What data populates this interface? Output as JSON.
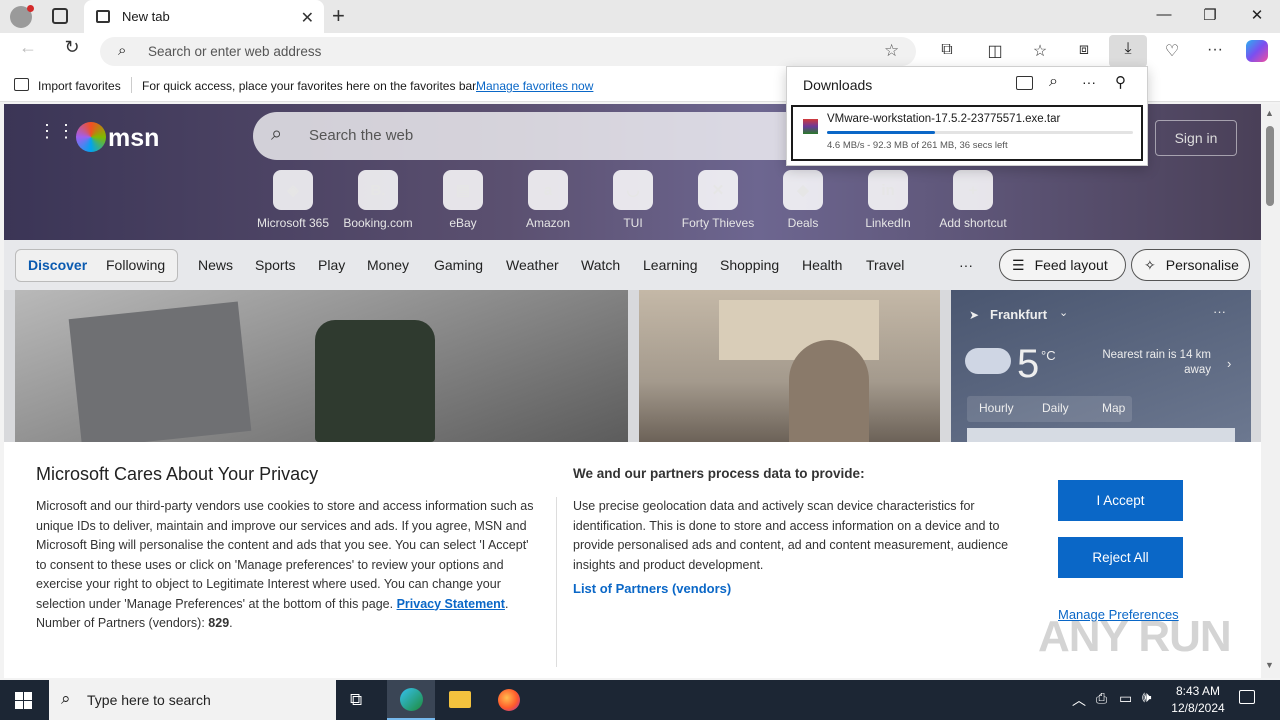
{
  "browser": {
    "tab_title": "New tab",
    "address_placeholder": "Search or enter web address",
    "favbar_import": "Import favorites",
    "favbar_hint": "For quick access, place your favorites here on the favorites bar.",
    "favbar_link": "Manage favorites now"
  },
  "downloads": {
    "title": "Downloads",
    "file_name": "VMware-workstation-17.5.2-23775571.exe.tar",
    "status": "4.6 MB/s - 92.3 MB of 261 MB, 36 secs left",
    "progress": 0.354
  },
  "msn": {
    "logo": "msn",
    "search_placeholder": "Search the web",
    "sign_in": "Sign in",
    "shortcuts": [
      {
        "label": "Microsoft 365",
        "glyph": "◈"
      },
      {
        "label": "Booking.com",
        "glyph": "B."
      },
      {
        "label": "eBay",
        "glyph": "▤"
      },
      {
        "label": "Amazon",
        "glyph": "a"
      },
      {
        "label": "TUI",
        "glyph": "◡"
      },
      {
        "label": "Forty Thieves",
        "glyph": "✕"
      },
      {
        "label": "Deals",
        "glyph": "◆"
      },
      {
        "label": "LinkedIn",
        "glyph": "in"
      },
      {
        "label": "Add shortcut",
        "glyph": "+"
      }
    ],
    "nav": {
      "discover": "Discover",
      "following": "Following",
      "items": [
        "News",
        "Sports",
        "Play",
        "Money",
        "Gaming",
        "Weather",
        "Watch",
        "Learning",
        "Shopping",
        "Health",
        "Travel"
      ],
      "more": "···",
      "feed_layout": "Feed layout",
      "personalise": "Personalise"
    },
    "weather": {
      "city": "Frankfurt",
      "temp": "5",
      "unit": "°C",
      "rain": "Nearest rain is 14 km away",
      "tabs": [
        "Hourly",
        "Daily",
        "Map"
      ]
    }
  },
  "privacy": {
    "title": "Microsoft Cares About Your Privacy",
    "body": "Microsoft and our third-party vendors use cookies to store and access information such as unique IDs to deliver, maintain and improve our services and ads. If you agree, MSN and Microsoft Bing will personalise the content and ads that you see. You can select 'I Accept' to consent to these uses or click on 'Manage preferences' to review your options and exercise your right to object to Legitimate Interest where used.  You can change your selection under 'Manage Preferences' at the bottom of this page.",
    "privacy_link": "Privacy Statement",
    "partners_label": "Number of Partners (vendors):",
    "partners_count": "829",
    "right_title": "We and our partners process data to provide:",
    "right_body": "Use precise geolocation data and actively scan device characteristics for identification. This is done to store and access information on a device and to provide personalised ads and content, ad and content measurement, audience insights and product development.",
    "partners_link": "List of Partners (vendors)",
    "accept": "I Accept",
    "reject": "Reject All",
    "manage": "Manage Preferences"
  },
  "taskbar": {
    "search": "Type here to search",
    "time": "8:43 AM",
    "date": "12/8/2024"
  },
  "watermark": "ANY RUN",
  "colors": {
    "accent": "#0a67c7",
    "taskbar": "#1c2634"
  }
}
